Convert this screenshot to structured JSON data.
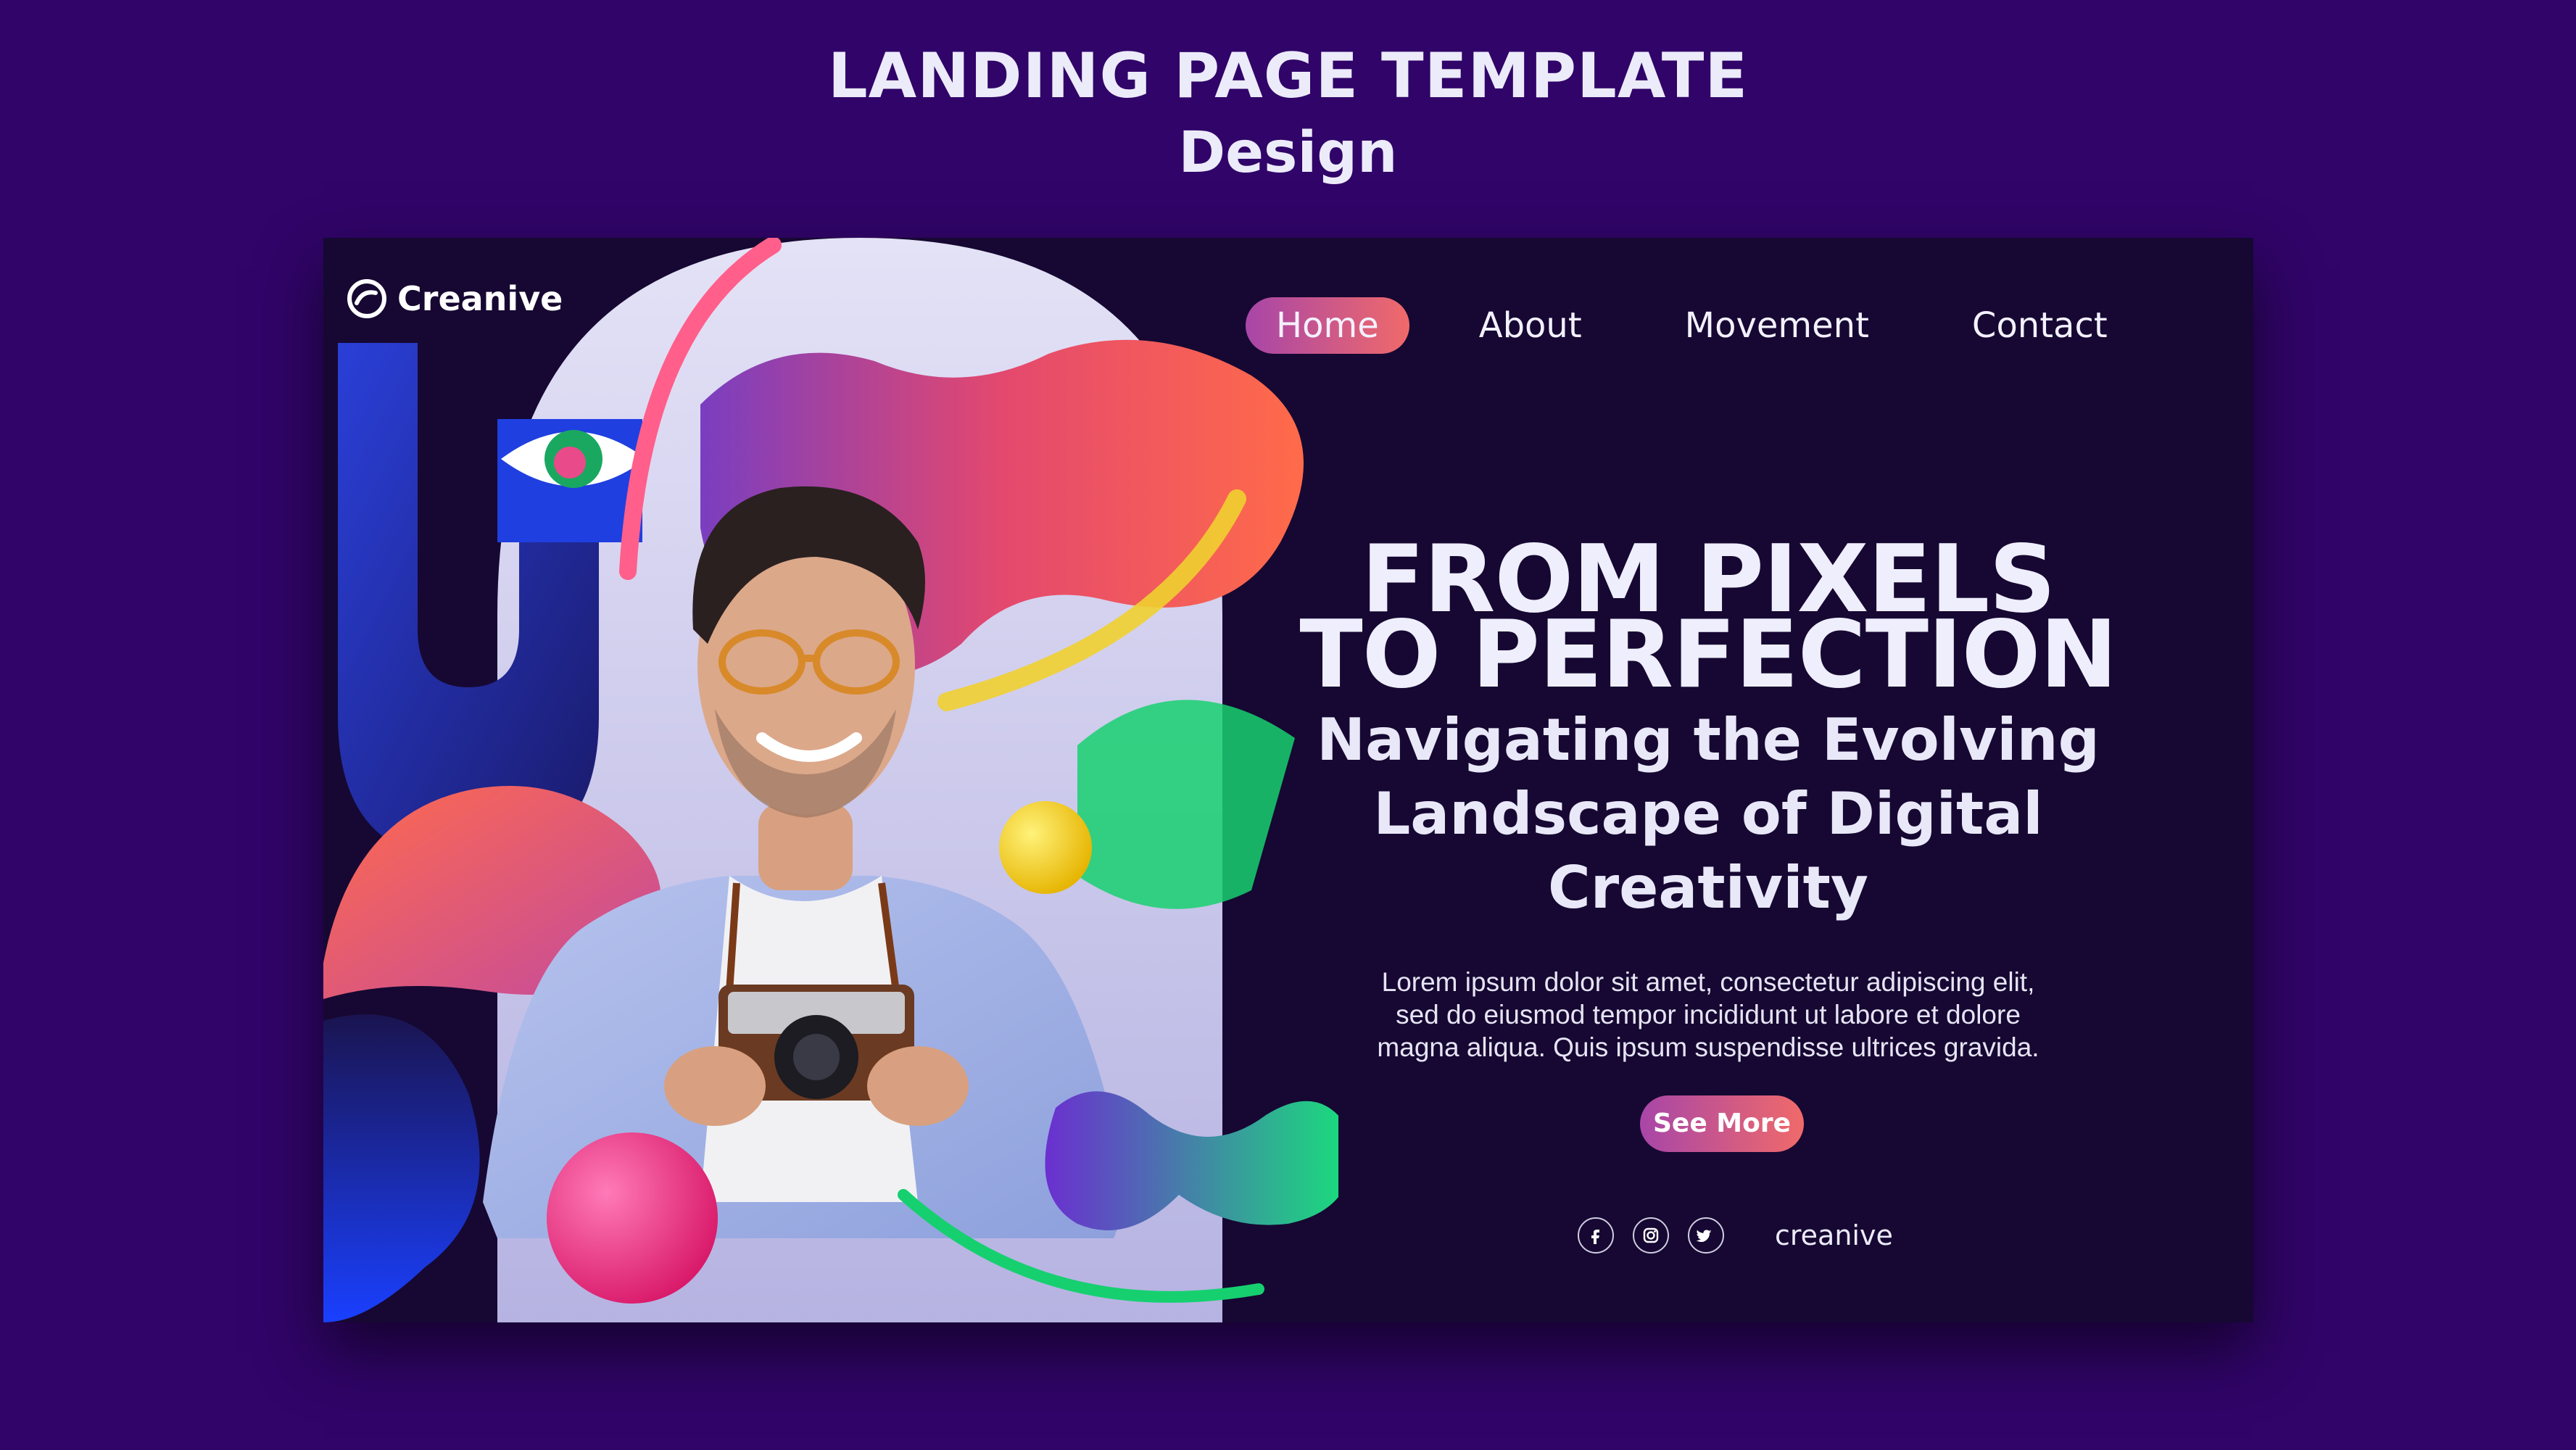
{
  "header": {
    "title": "LANDING PAGE TEMPLATE",
    "subtitle": "Design"
  },
  "brand": {
    "name": "Creanive",
    "logo_icon": "swirl-logo-icon"
  },
  "nav": {
    "items": [
      {
        "label": "Home",
        "active": true
      },
      {
        "label": "About",
        "active": false
      },
      {
        "label": "Movement",
        "active": false
      },
      {
        "label": "Contact",
        "active": false
      }
    ]
  },
  "hero": {
    "headline_line1": "FROM PIXELS",
    "headline_line2": "TO PERFECTION",
    "subheadline_line1": "Navigating the Evolving",
    "subheadline_line2": "Landscape of Digital Creativity",
    "body_line1": "Lorem ipsum dolor sit amet, consectetur adipiscing elit,",
    "body_line2": "sed do eiusmod tempor incididunt ut labore et dolore",
    "body_line3": "magna aliqua. Quis ipsum suspendisse ultrices gravida.",
    "cta_label": "See More"
  },
  "social": {
    "icons": [
      "facebook-icon",
      "instagram-icon",
      "twitter-icon"
    ],
    "handle": "creanive"
  },
  "colors": {
    "page_bg": "#300468",
    "card_bg": "#160832",
    "accent_start": "#a846a8",
    "accent_end": "#f06a6a"
  }
}
